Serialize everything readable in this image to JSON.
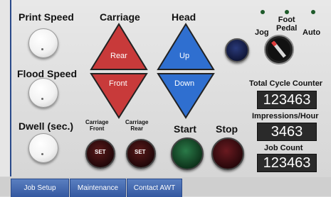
{
  "left_labels": {
    "print_speed": "Print Speed",
    "flood_speed": "Flood Speed",
    "dwell": "Dwell (sec.)"
  },
  "carriage": {
    "title": "Carriage",
    "rear": "Rear",
    "front": "Front"
  },
  "head": {
    "title": "Head",
    "up": "Up",
    "down": "Down"
  },
  "mode": {
    "jog": "Jog",
    "foot_pedal": "Foot\nPedal",
    "auto": "Auto"
  },
  "counters": {
    "total_label": "Total Cycle Counter",
    "total_value": "123463",
    "iph_label": "Impressions/Hour",
    "iph_value": "3463",
    "job_label": "Job Count",
    "job_value": "123463"
  },
  "buttons": {
    "carriage_front": "Carriage\nFront",
    "carriage_rear": "Carriage\nRear",
    "set": "SET",
    "start": "Start",
    "stop": "Stop"
  },
  "tabs": [
    "Job Setup",
    "Maintenance",
    "Contact AWT"
  ],
  "colors": {
    "rear_red": "#c83a3a",
    "up_blue": "#2f6fd0",
    "start_green": "#1a5a32",
    "stop_red": "#5a1216",
    "tab_blue": "#3f64ac"
  }
}
